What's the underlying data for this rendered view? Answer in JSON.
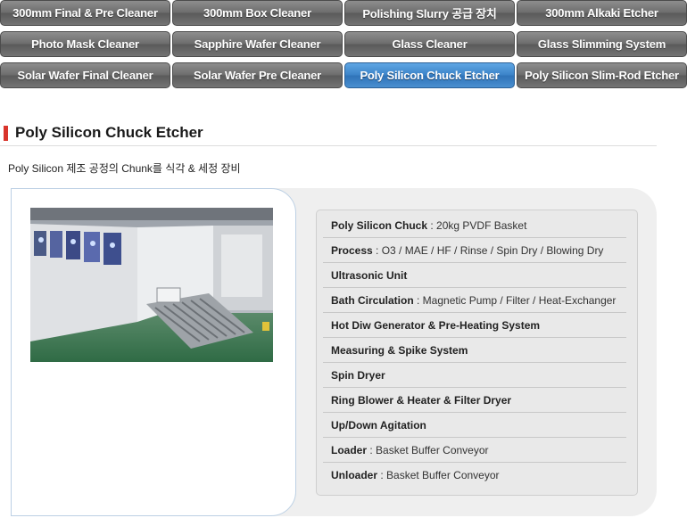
{
  "tabs": [
    {
      "label": "300mm Final & Pre Cleaner",
      "active": false
    },
    {
      "label": "300mm Box Cleaner",
      "active": false
    },
    {
      "label": "Polishing Slurry 공급 장치",
      "active": false
    },
    {
      "label": "300mm Alkaki Etcher",
      "active": false
    },
    {
      "label": "Photo Mask Cleaner",
      "active": false
    },
    {
      "label": "Sapphire Wafer Cleaner",
      "active": false
    },
    {
      "label": "Glass Cleaner",
      "active": false
    },
    {
      "label": "Glass Slimming System",
      "active": false
    },
    {
      "label": "Solar Wafer Final Cleaner",
      "active": false
    },
    {
      "label": "Solar Wafer Pre Cleaner",
      "active": false
    },
    {
      "label": "Poly Silicon Chuck Etcher",
      "active": true
    },
    {
      "label": "Poly Silicon Slim-Rod Etcher",
      "active": false
    }
  ],
  "title": "Poly Silicon Chuck Etcher",
  "description": "Poly Silicon 제조 공정의 Chunk를 식각 & 세정 장비",
  "specs": [
    {
      "name": "Poly Silicon Chuck",
      "value": " : 20kg PVDF Basket"
    },
    {
      "name": "Process",
      "value": " : O3 / MAE / HF / Rinse / Spin Dry / Blowing Dry"
    },
    {
      "name": "Ultrasonic Unit",
      "value": ""
    },
    {
      "name": "Bath Circulation",
      "value": " : Magnetic Pump / Filter / Heat-Exchanger"
    },
    {
      "name": "Hot Diw Generator & Pre-Heating System",
      "value": ""
    },
    {
      "name": "Measuring & Spike System",
      "value": ""
    },
    {
      "name": "Spin Dryer",
      "value": ""
    },
    {
      "name": "Ring Blower & Heater & Filter Dryer",
      "value": ""
    },
    {
      "name": "Up/Down Agitation",
      "value": ""
    },
    {
      "name": "Loader",
      "value": " : Basket Buffer Conveyor"
    },
    {
      "name": "Unloader",
      "value": " : Basket Buffer Conveyor"
    }
  ],
  "colors": {
    "tab_default": "#6d6d6d",
    "tab_active": "#3c84c9",
    "title_accent": "#d9342b",
    "panel_bg": "#efefef"
  }
}
